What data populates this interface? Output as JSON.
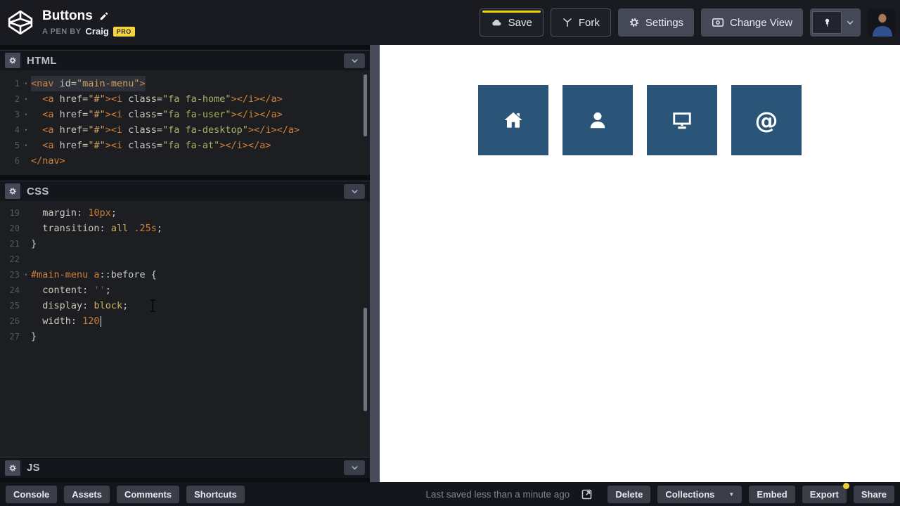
{
  "header": {
    "title": "Buttons",
    "pen_by": "A PEN BY",
    "author": "Craig",
    "pro_badge": "PRO",
    "save_label": "Save",
    "fork_label": "Fork",
    "settings_label": "Settings",
    "change_view_label": "Change View"
  },
  "editors": {
    "html": {
      "label": "HTML",
      "lines": [
        {
          "no": "1",
          "fold": true,
          "hl": true,
          "tokens": [
            [
              "tag",
              "<nav"
            ],
            [
              "plain",
              " "
            ],
            [
              "attr",
              "id="
            ],
            [
              "stra",
              "\"main-menu\""
            ],
            [
              "tag",
              ">"
            ]
          ]
        },
        {
          "no": "2",
          "fold": true,
          "tokens": [
            [
              "plain",
              "  "
            ],
            [
              "tag",
              "<a"
            ],
            [
              "plain",
              " "
            ],
            [
              "attr",
              "href="
            ],
            [
              "stra",
              "\"#\""
            ],
            [
              "tag",
              "><i"
            ],
            [
              "plain",
              " "
            ],
            [
              "attr",
              "class="
            ],
            [
              "strg",
              "\"fa fa-home\""
            ],
            [
              "tag",
              "></i></a>"
            ]
          ]
        },
        {
          "no": "3",
          "fold": true,
          "tokens": [
            [
              "plain",
              "  "
            ],
            [
              "tag",
              "<a"
            ],
            [
              "plain",
              " "
            ],
            [
              "attr",
              "href="
            ],
            [
              "stra",
              "\"#\""
            ],
            [
              "tag",
              "><i"
            ],
            [
              "plain",
              " "
            ],
            [
              "attr",
              "class="
            ],
            [
              "strg",
              "\"fa fa-user\""
            ],
            [
              "tag",
              "></i></a>"
            ]
          ]
        },
        {
          "no": "4",
          "fold": true,
          "tokens": [
            [
              "plain",
              "  "
            ],
            [
              "tag",
              "<a"
            ],
            [
              "plain",
              " "
            ],
            [
              "attr",
              "href="
            ],
            [
              "stra",
              "\"#\""
            ],
            [
              "tag",
              "><i"
            ],
            [
              "plain",
              " "
            ],
            [
              "attr",
              "class="
            ],
            [
              "strg",
              "\"fa fa-desktop\""
            ],
            [
              "tag",
              "></i></a>"
            ]
          ]
        },
        {
          "no": "5",
          "fold": true,
          "tokens": [
            [
              "plain",
              "  "
            ],
            [
              "tag",
              "<a"
            ],
            [
              "plain",
              " "
            ],
            [
              "attr",
              "href="
            ],
            [
              "stra",
              "\"#\""
            ],
            [
              "tag",
              "><i"
            ],
            [
              "plain",
              " "
            ],
            [
              "attr",
              "class="
            ],
            [
              "strg",
              "\"fa fa-at\""
            ],
            [
              "tag",
              "></i></a>"
            ]
          ]
        },
        {
          "no": "6",
          "tokens": [
            [
              "tag",
              "</nav>"
            ]
          ]
        }
      ]
    },
    "css": {
      "label": "CSS",
      "lines": [
        {
          "no": "19",
          "tokens": [
            [
              "plain",
              "  "
            ],
            [
              "attr",
              "margin"
            ],
            [
              "plain",
              ": "
            ],
            [
              "num",
              "10px"
            ],
            [
              "plain",
              ";"
            ]
          ]
        },
        {
          "no": "20",
          "tokens": [
            [
              "plain",
              "  "
            ],
            [
              "attr",
              "transition"
            ],
            [
              "plain",
              ": "
            ],
            [
              "kw",
              "all"
            ],
            [
              "plain",
              " "
            ],
            [
              "num",
              ".25s"
            ],
            [
              "plain",
              ";"
            ]
          ]
        },
        {
          "no": "21",
          "tokens": [
            [
              "plain",
              "}"
            ]
          ]
        },
        {
          "no": "22",
          "tokens": []
        },
        {
          "no": "23",
          "fold": true,
          "tokens": [
            [
              "tag",
              "#main-menu a"
            ],
            [
              "plain",
              "::before {"
            ]
          ]
        },
        {
          "no": "24",
          "tokens": [
            [
              "plain",
              "  "
            ],
            [
              "attr",
              "content"
            ],
            [
              "plain",
              ": "
            ],
            [
              "qd",
              "''"
            ],
            [
              "plain",
              ";"
            ]
          ]
        },
        {
          "no": "25",
          "tokens": [
            [
              "plain",
              "  "
            ],
            [
              "attr",
              "display"
            ],
            [
              "plain",
              ": "
            ],
            [
              "kw",
              "block"
            ],
            [
              "plain",
              ";"
            ]
          ]
        },
        {
          "no": "26",
          "tokens": [
            [
              "plain",
              "  "
            ],
            [
              "attr",
              "width"
            ],
            [
              "plain",
              ": "
            ],
            [
              "num",
              "120"
            ],
            [
              "caret",
              ""
            ]
          ]
        },
        {
          "no": "27",
          "tokens": [
            [
              "plain",
              "}"
            ]
          ]
        }
      ]
    },
    "js": {
      "label": "JS"
    }
  },
  "preview": {
    "tiles": [
      {
        "name": "home",
        "icon": "home-icon"
      },
      {
        "name": "user",
        "icon": "user-icon"
      },
      {
        "name": "desktop",
        "icon": "desktop-icon"
      },
      {
        "name": "at",
        "icon": "at-icon"
      }
    ]
  },
  "footer": {
    "left_buttons": [
      {
        "label": "Console"
      },
      {
        "label": "Assets"
      },
      {
        "label": "Comments"
      },
      {
        "label": "Shortcuts"
      }
    ],
    "last_saved": "Last saved less than a minute ago",
    "right_buttons": [
      {
        "label": "Delete"
      },
      {
        "label": "Collections",
        "caret": true
      },
      {
        "label": "Embed"
      },
      {
        "label": "Export",
        "dot": true
      },
      {
        "label": "Share"
      }
    ]
  },
  "colors": {
    "topbar-bg": "#1a1b21",
    "panel-gap": "#0d0e12",
    "section-header-bg": "#15161b",
    "editor-bg": "#1d1e22",
    "btn-gray": "#444857",
    "divider": "#474b5c",
    "accent-yellow": "#f5d300",
    "pro-badge": "#f5d43f",
    "tile-blue": "#2a5579",
    "footer-bg": "#15161b",
    "footer-btn": "#3a3e49",
    "syntax-tag": "#d0803a",
    "syntax-attr": "#cbcabd",
    "syntax-string-amber": "#cfa05a",
    "syntax-string-green": "#a9b162",
    "syntax-number": "#cf7d35",
    "syntax-keyword": "#cfaf56",
    "syntax-plain": "#c9cad2"
  }
}
